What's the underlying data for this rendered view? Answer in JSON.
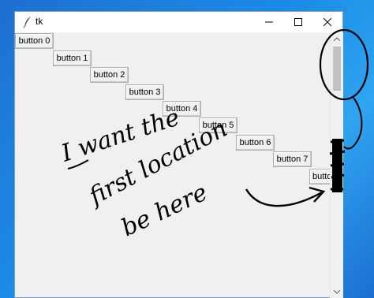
{
  "window": {
    "title": "tk"
  },
  "titlebar": {
    "minimize_label": "—",
    "maximize_label": "☐",
    "close_label": "✕"
  },
  "buttons": [
    {
      "label": "button 0"
    },
    {
      "label": "button 1"
    },
    {
      "label": "button 2"
    },
    {
      "label": "button 3"
    },
    {
      "label": "button 4"
    },
    {
      "label": "button 5"
    },
    {
      "label": "button 6"
    },
    {
      "label": "button 7"
    },
    {
      "label": "butto"
    }
  ],
  "annotation": {
    "text_lines": [
      "I want the",
      "first location",
      "be here"
    ],
    "ink_color": "#000000"
  },
  "colors": {
    "desktop": "#1c8ce6",
    "window_bg": "#f0f0f0",
    "scroll_thumb": "#c1c1c1"
  }
}
